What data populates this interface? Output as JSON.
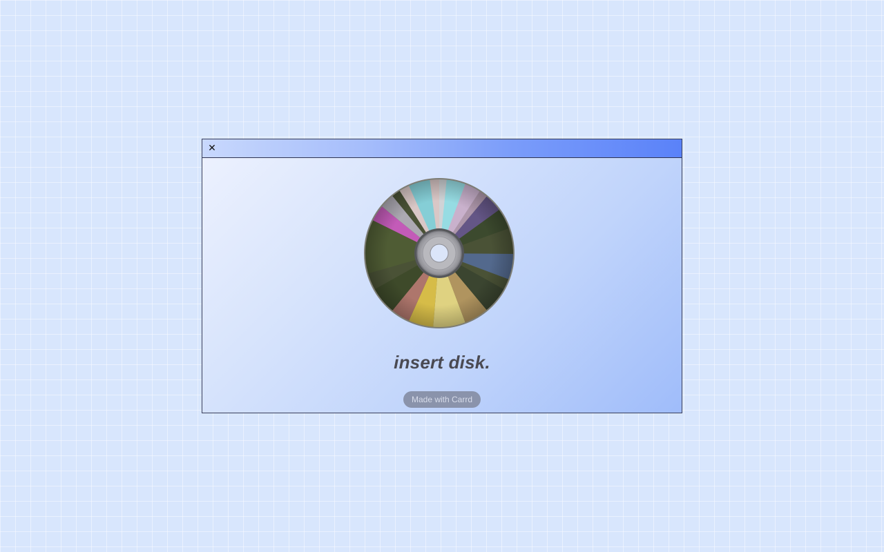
{
  "window": {
    "close_icon": "✕",
    "disc_icon": "compact-disc-icon"
  },
  "main": {
    "headline": "insert disk.",
    "credit_label": "Made with Carrd"
  },
  "colors": {
    "background": "#d8e6fd",
    "titlebar_start": "#c8d8fd",
    "titlebar_end": "#5a82f9",
    "headline": "#4a4a52",
    "credit_badge": "#8a93ab"
  }
}
